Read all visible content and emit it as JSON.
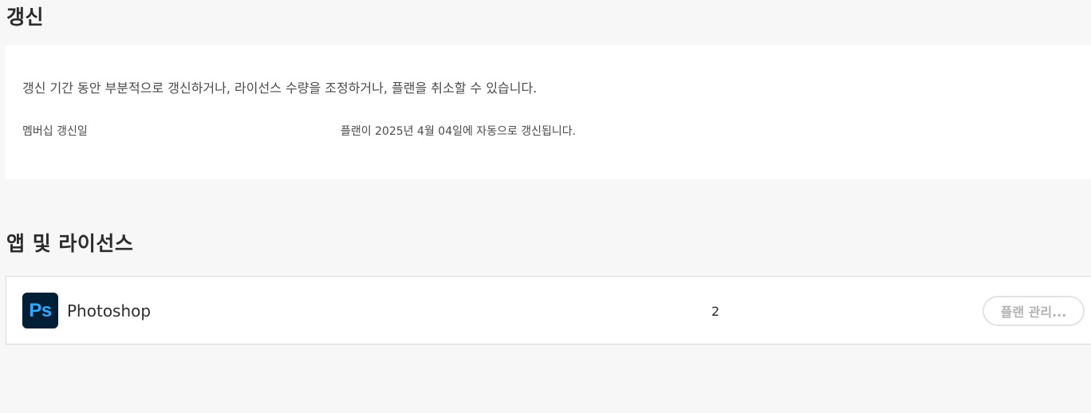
{
  "renewal": {
    "title": "갱신",
    "description": "갱신 기간 동안 부분적으로 갱신하거나, 라이선스 수량을 조정하거나, 플랜을 취소할 수 있습니다.",
    "membership_label": "멤버십 갱신일",
    "membership_value": "플랜이 2025년 4월 04일에 자동으로 갱신됩니다."
  },
  "apps": {
    "title": "앱 및 라이선스",
    "items": [
      {
        "icon_text": "Ps",
        "icon_name": "photoshop-icon",
        "icon_bg": "#001e36",
        "icon_fg": "#31a8ff",
        "name": "Photoshop",
        "count": "2",
        "manage_label": "플랜 관리..."
      }
    ]
  }
}
